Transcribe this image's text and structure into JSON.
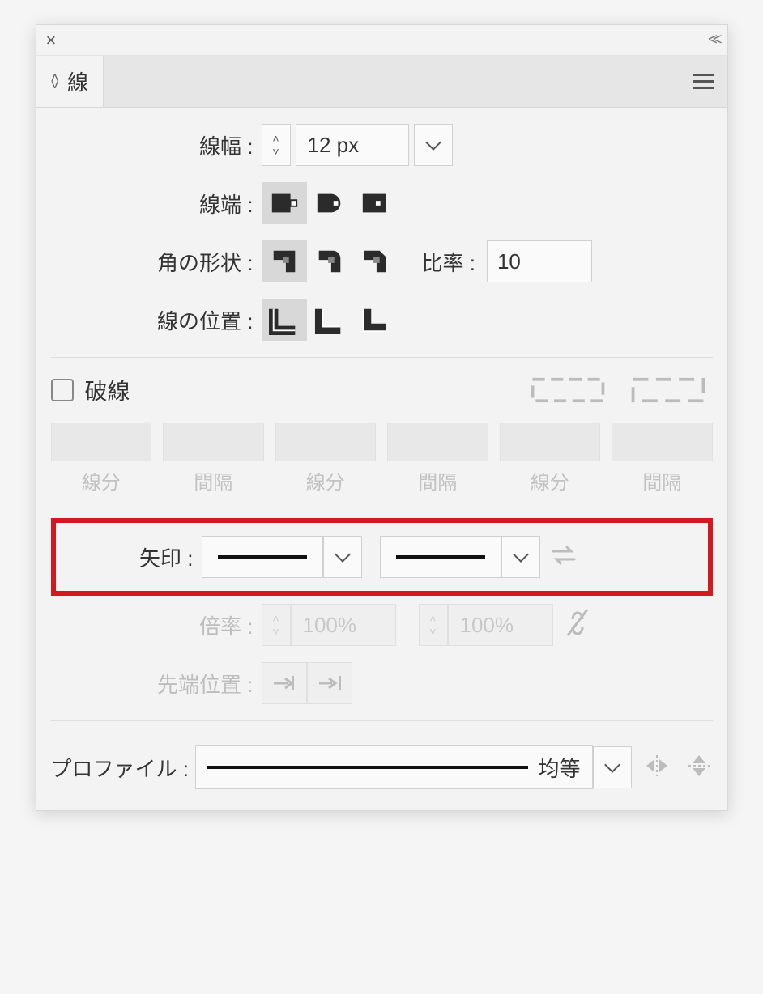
{
  "panel": {
    "tab_title": "線",
    "close": "×",
    "collapse": "<<"
  },
  "stroke": {
    "width_label": "線幅 :",
    "width_value": "12 px",
    "cap_label": "線端 :",
    "join_label": "角の形状 :",
    "ratio_label": "比率 :",
    "ratio_value": "10",
    "align_label": "線の位置 :"
  },
  "dash": {
    "checkbox_label": "破線",
    "cols": [
      "線分",
      "間隔",
      "線分",
      "間隔",
      "線分",
      "間隔"
    ]
  },
  "arrows": {
    "label": "矢印 :",
    "scale_label": "倍率 :",
    "scale_start": "100%",
    "scale_end": "100%",
    "tip_align_label": "先端位置 :"
  },
  "profile": {
    "label": "プロファイル :",
    "value": "均等"
  }
}
